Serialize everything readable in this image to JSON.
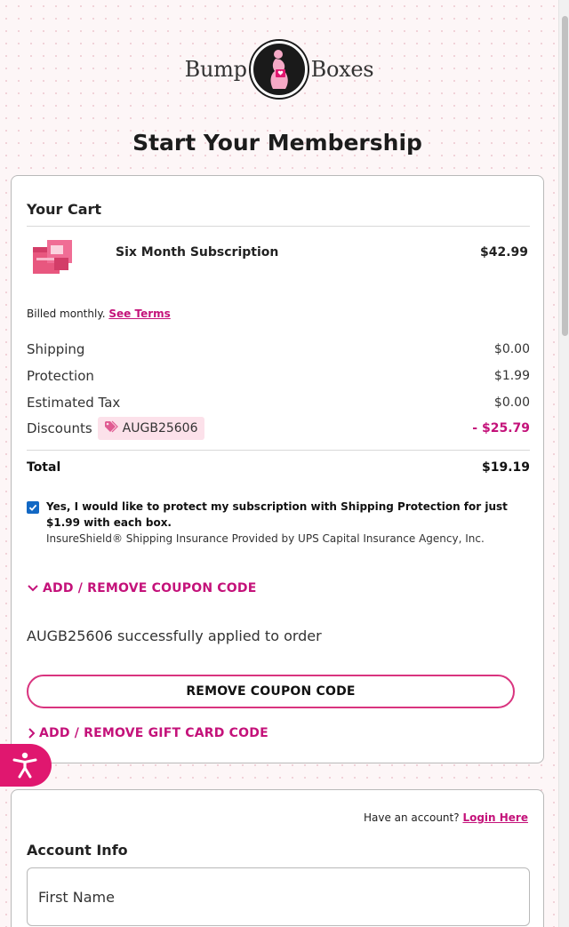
{
  "brand": {
    "word_left": "Bump",
    "word_right": "Boxes"
  },
  "page_title": "Start Your Membership",
  "cart": {
    "title": "Your Cart",
    "product": {
      "name": "Six Month Subscription",
      "price": "$42.99"
    },
    "billed_text": "Billed monthly.",
    "see_terms": "See Terms",
    "lines": {
      "shipping": {
        "label": "Shipping",
        "value": "$0.00"
      },
      "protection": {
        "label": "Protection",
        "value": "$1.99"
      },
      "tax": {
        "label": "Estimated Tax",
        "value": "$0.00"
      },
      "discounts": {
        "label": "Discounts",
        "code": "AUGB25606",
        "value": "- $25.79"
      }
    },
    "total": {
      "label": "Total",
      "value": "$19.19"
    },
    "protection_opt_in": {
      "checked": true,
      "main_text": "Yes, I would like to protect my subscription with Shipping Protection for just $1.99 with each box.",
      "sub_text": "InsureShield® Shipping Insurance Provided by UPS Capital Insurance Agency, Inc."
    },
    "coupon_toggle": "ADD / REMOVE COUPON CODE",
    "applied_message": "AUGB25606 successfully applied to order",
    "remove_coupon_button": "REMOVE COUPON CODE",
    "gift_card_toggle": "ADD / REMOVE GIFT CARD CODE"
  },
  "account": {
    "have_account_text": "Have an account?",
    "login_link": "Login Here",
    "title": "Account Info",
    "first_name_placeholder": "First Name"
  },
  "colors": {
    "accent": "#c4127a",
    "button_border": "#d9347f",
    "a11y_bg": "#e0176f",
    "checkbox": "#1268c4"
  },
  "icons": [
    "pregnant-woman-logo-icon",
    "tag-icon",
    "chevron-down-icon",
    "chevron-right-icon",
    "check-icon",
    "accessibility-icon"
  ]
}
